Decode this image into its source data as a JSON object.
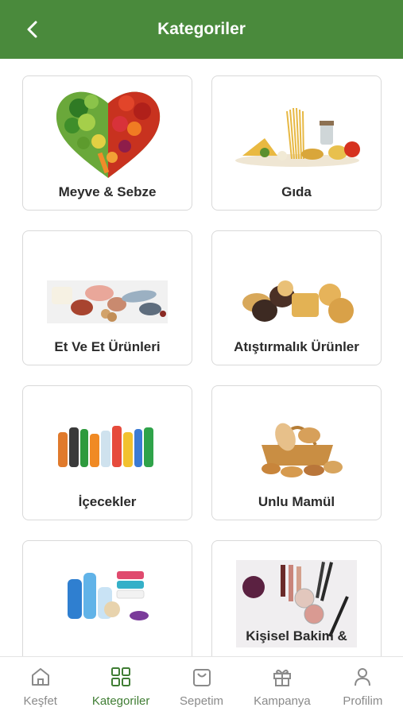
{
  "header": {
    "title": "Kategoriler",
    "back_icon": "chevron-left-icon"
  },
  "colors": {
    "brand": "#4a8a3c",
    "active_tab": "#3f7d33",
    "inactive_tab": "#8a8a8a"
  },
  "categories": [
    {
      "label": "Meyve & Sebze",
      "icon": "fruit-vegetable-heart-image"
    },
    {
      "label": "Gıda",
      "icon": "pasta-groceries-image"
    },
    {
      "label": "Et Ve Et Ürünleri",
      "icon": "meat-fish-image"
    },
    {
      "label": "Atıştırmalık Ürünler",
      "icon": "cookies-snacks-image"
    },
    {
      "label": "İçecekler",
      "icon": "beverage-bottles-image"
    },
    {
      "label": "Unlu Mamül",
      "icon": "bread-basket-image"
    },
    {
      "label": "",
      "icon": "cleaning-products-image"
    },
    {
      "label": "Kişisel Bakim &",
      "icon": "cosmetics-image"
    }
  ],
  "tabs": [
    {
      "label": "Keşfet",
      "icon": "home-icon",
      "active": false
    },
    {
      "label": "Kategoriler",
      "icon": "grid-icon",
      "active": true
    },
    {
      "label": "Sepetim",
      "icon": "bag-icon",
      "active": false
    },
    {
      "label": "Kampanya",
      "icon": "gift-icon",
      "active": false
    },
    {
      "label": "Profilim",
      "icon": "user-icon",
      "active": false
    }
  ]
}
